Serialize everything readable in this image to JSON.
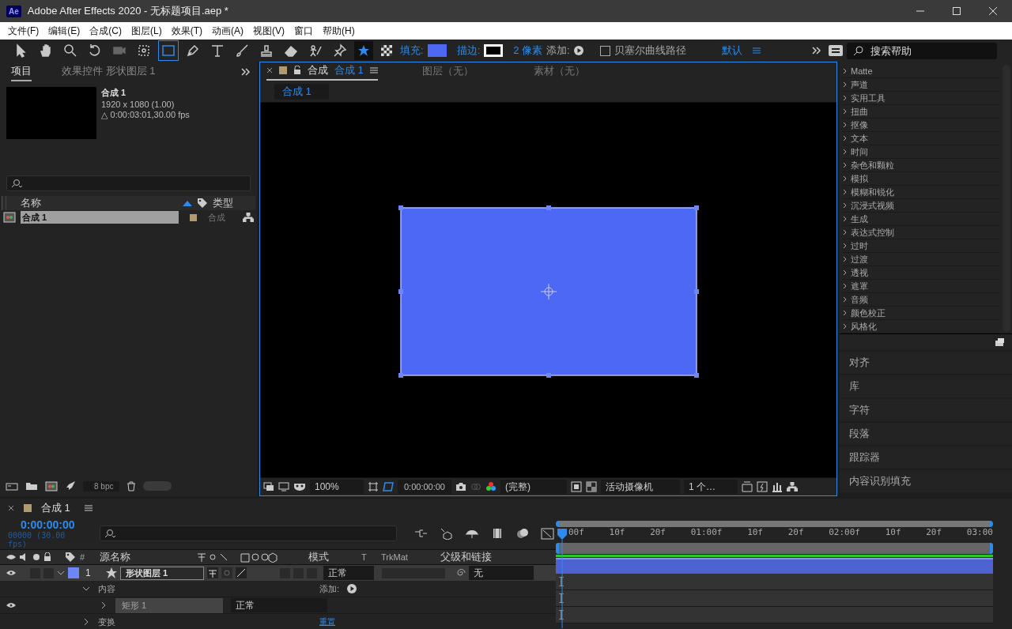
{
  "window": {
    "app_icon": "Ae",
    "title": "Adobe After Effects 2020 - 无标题项目.aep *"
  },
  "menu": [
    "文件(F)",
    "编辑(E)",
    "合成(C)",
    "图层(L)",
    "效果(T)",
    "动画(A)",
    "视图(V)",
    "窗口",
    "帮助(H)"
  ],
  "toolbar": {
    "tools": [
      {
        "kind": "select",
        "selected": false
      },
      {
        "kind": "hand",
        "selected": false
      },
      {
        "kind": "zoom",
        "selected": false
      },
      {
        "kind": "rotate",
        "selected": false
      },
      {
        "kind": "camera",
        "selected": false
      },
      {
        "kind": "pan",
        "selected": false
      },
      {
        "kind": "rectangle",
        "selected": true
      },
      {
        "kind": "pen",
        "selected": false
      },
      {
        "kind": "text",
        "selected": false
      },
      {
        "kind": "brush",
        "selected": false
      },
      {
        "kind": "stamp",
        "selected": false
      },
      {
        "kind": "eraser",
        "selected": false
      },
      {
        "kind": "roto",
        "selected": false
      },
      {
        "kind": "pin",
        "selected": false
      }
    ],
    "shape_modes": [
      {
        "kind": "star",
        "selected": true
      },
      {
        "kind": "checker",
        "selected": false
      }
    ],
    "fill_label": "填充:",
    "stroke_label": "描边:",
    "stroke_width": "2 像素",
    "add_label": "添加:",
    "bezier_path": {
      "label": "贝塞尔曲线路径",
      "checked": false
    },
    "workspace": "默认",
    "help_search": {
      "placeholder": "搜索帮助"
    }
  },
  "project": {
    "tabs": [
      {
        "label": "项目",
        "selected": true
      },
      {
        "label": "效果控件 形状图层 1",
        "selected": false
      }
    ],
    "preview": {
      "name": "合成 1",
      "size": "1920 x 1080 (1.00)",
      "duration": "△ 0:00:03:01,30.00 fps"
    },
    "columns": [
      "名称",
      "类型"
    ],
    "items": [
      {
        "name": "合成 1",
        "type": "合成",
        "selected": true
      }
    ],
    "bit_depth": "8 bpc"
  },
  "composition": {
    "tabs": [
      {
        "label": "合成",
        "name": "合成 1",
        "selected": true
      },
      {
        "label": "图层（无）",
        "selected": false
      },
      {
        "label": "素材（无）",
        "selected": false
      }
    ],
    "breadcrumb": "合成 1",
    "zoom": "100%",
    "timecode": "0:00:00:00",
    "resolution": "(完整)",
    "camera": "活动摄像机",
    "views": "1 个…"
  },
  "effects": {
    "categories": [
      "Matte",
      "声道",
      "实用工具",
      "扭曲",
      "抠像",
      "文本",
      "时间",
      "杂色和颗粒",
      "模拟",
      "模糊和锐化",
      "沉浸式视频",
      "生成",
      "表达式控制",
      "过时",
      "过渡",
      "透视",
      "遮罩",
      "音频",
      "颜色校正",
      "风格化"
    ],
    "panels": [
      "对齐",
      "库",
      "字符",
      "段落",
      "跟踪器",
      "内容识别填充"
    ]
  },
  "timeline": {
    "tab": "合成 1",
    "timecode": "0:00:00:00",
    "frame_info": "00000 (30.00 fps)",
    "columns": {
      "number": "#",
      "source": "源名称",
      "mode": "模式",
      "t": "T",
      "trkmat": "TrkMat",
      "parent": "父级和链接"
    },
    "layer": {
      "number": "1",
      "name": "形状图层 1",
      "mode": "正常",
      "parent": "无",
      "visible": true,
      "expanded": true,
      "switches": [
        {
          "kind": "shy",
          "on": true
        },
        {
          "kind": "collapse",
          "on": false
        },
        {
          "kind": "quality",
          "on": true
        }
      ]
    },
    "properties": [
      {
        "kind": "group",
        "name": "内容",
        "expanded": true,
        "action": "添加:"
      },
      {
        "kind": "shape",
        "name": "矩形 1",
        "expanded": false,
        "mode": "正常",
        "visible": true
      },
      {
        "kind": "group",
        "name": "变换",
        "expanded": false,
        "link": "重置"
      }
    ],
    "ruler": [
      "00f",
      "10f",
      "20f",
      "01:00f",
      "10f",
      "20f",
      "02:00f",
      "10f",
      "20f",
      "03:00"
    ]
  }
}
